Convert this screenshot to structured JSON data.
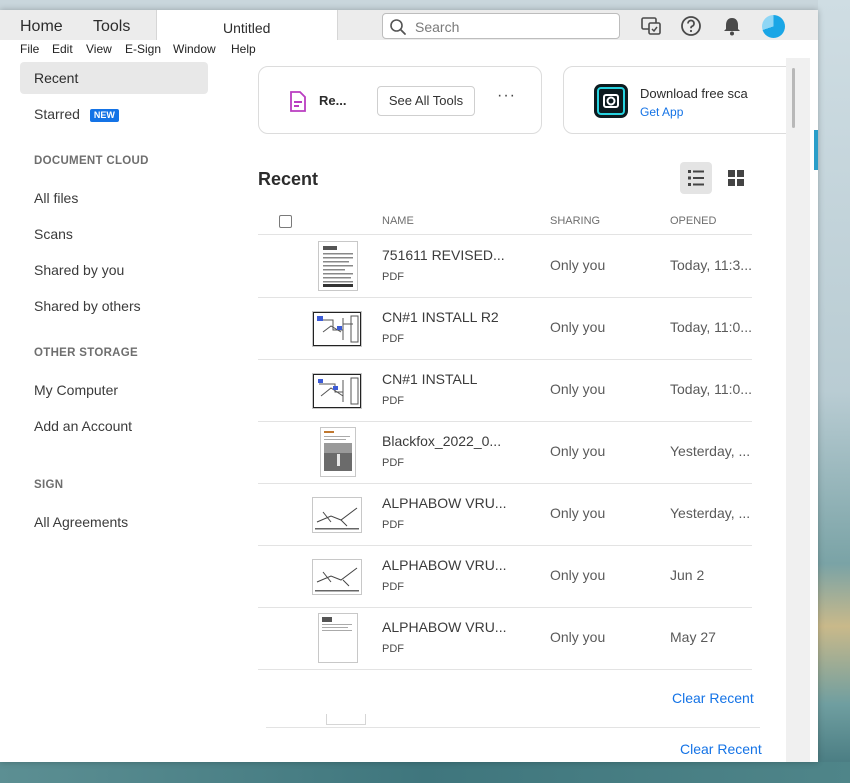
{
  "topbar": {
    "tabs": [
      {
        "label": "Home"
      },
      {
        "label": "Tools"
      }
    ],
    "doc_tab": "Untitled",
    "search_placeholder": "Search"
  },
  "menu": [
    "File",
    "Edit",
    "View",
    "E-Sign",
    "Window",
    "Help"
  ],
  "sidebar": {
    "recent": "Recent",
    "starred": "Starred",
    "new_badge": "NEW",
    "document_cloud_header": "DOCUMENT CLOUD",
    "cloud_items": [
      "All files",
      "Scans",
      "Shared by you",
      "Shared by others"
    ],
    "other_storage_header": "OTHER STORAGE",
    "storage_items": [
      "My Computer",
      "Add an Account"
    ],
    "sign_header": "SIGN",
    "sign_items": [
      "All Agreements"
    ]
  },
  "tools_card": {
    "tool_name": "Re...",
    "see_all": "See All Tools",
    "more": "···"
  },
  "scan_card": {
    "title": "Download free sca",
    "link": "Get App"
  },
  "recent": {
    "title": "Recent",
    "columns": {
      "name": "NAME",
      "sharing": "SHARING",
      "opened": "OPENED"
    },
    "rows": [
      {
        "name": "751611 REVISED...",
        "type": "PDF",
        "sharing": "Only you",
        "opened": "Today, 11:3..."
      },
      {
        "name": "CN#1 INSTALL R2",
        "type": "PDF",
        "sharing": "Only you",
        "opened": "Today, 11:0..."
      },
      {
        "name": "CN#1 INSTALL",
        "type": "PDF",
        "sharing": "Only you",
        "opened": "Today, 11:0..."
      },
      {
        "name": "Blackfox_2022_0...",
        "type": "PDF",
        "sharing": "Only you",
        "opened": "Yesterday, ..."
      },
      {
        "name": "ALPHABOW VRU...",
        "type": "PDF",
        "sharing": "Only you",
        "opened": "Yesterday, ..."
      },
      {
        "name": "ALPHABOW VRU...",
        "type": "PDF",
        "sharing": "Only you",
        "opened": "Jun 2"
      },
      {
        "name": "ALPHABOW VRU...",
        "type": "PDF",
        "sharing": "Only you",
        "opened": "May 27"
      }
    ],
    "clear_recent": "Clear Recent",
    "clear_recent_2": "Clear Recent"
  },
  "colors": {
    "accent": "#1473e6",
    "active_bg": "#e8e8e8",
    "topbar_bg": "#ececec"
  }
}
